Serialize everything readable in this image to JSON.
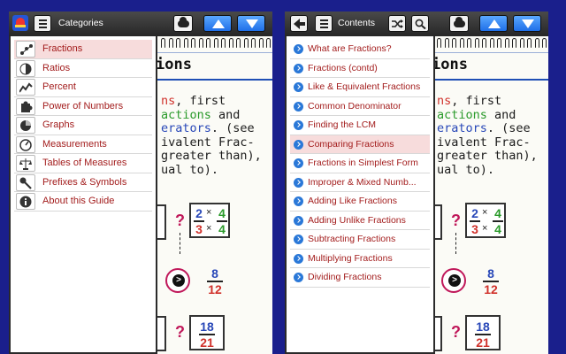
{
  "left_panel": {
    "menu": {
      "title": "Categories",
      "items": [
        {
          "label": "Fractions",
          "icon": "molecule-icon",
          "selected": true
        },
        {
          "label": "Ratios",
          "icon": "half-circle-icon"
        },
        {
          "label": "Percent",
          "icon": "line-graph-icon"
        },
        {
          "label": "Power of Numbers",
          "icon": "puzzle-icon"
        },
        {
          "label": "Graphs",
          "icon": "pie-chart-icon"
        },
        {
          "label": "Measurements",
          "icon": "gauge-icon"
        },
        {
          "label": "Tables of Measures",
          "icon": "scales-icon"
        },
        {
          "label": "Prefixes & Symbols",
          "icon": "key-icon"
        },
        {
          "label": "About this Guide",
          "icon": "info-icon"
        }
      ]
    }
  },
  "right_panel": {
    "menu": {
      "title": "Contents",
      "items": [
        {
          "label": "What are Fractions?"
        },
        {
          "label": "Fractions (contd)"
        },
        {
          "label": "Like & Equivalent Fractions"
        },
        {
          "label": "Common Denominator"
        },
        {
          "label": "Finding the LCM"
        },
        {
          "label": "Comparing Fractions",
          "selected": true
        },
        {
          "label": "Fractions in Simplest Form"
        },
        {
          "label": "Improper & Mixed Numb..."
        },
        {
          "label": "Adding Like Fractions"
        },
        {
          "label": "Adding Unlike Fractions"
        },
        {
          "label": "Subtracting Fractions"
        },
        {
          "label": "Multiplying Fractions"
        },
        {
          "label": "Dividing Fractions"
        }
      ]
    }
  },
  "page": {
    "title_fragment": "ions",
    "text_lines": [
      {
        "parts": [
          {
            "t": "ns",
            "c": "red"
          },
          {
            "t": ", first",
            "c": ""
          }
        ]
      },
      {
        "parts": [
          {
            "t": "actions",
            "c": "green"
          },
          {
            "t": " and",
            "c": ""
          }
        ]
      },
      {
        "parts": [
          {
            "t": "erators",
            "c": "blue"
          },
          {
            "t": ". (see",
            "c": ""
          }
        ]
      },
      {
        "parts": [
          {
            "t": "ivalent Frac-",
            "c": ""
          }
        ]
      },
      {
        "parts": [
          {
            "t": "greater than),",
            "c": ""
          }
        ]
      },
      {
        "parts": [
          {
            "t": "ual to).",
            "c": ""
          }
        ]
      }
    ],
    "question_mark": "?",
    "times_sign": "×",
    "compare_symbol": ">",
    "frac_a": {
      "num1": "2",
      "den1": "3",
      "num2": "4",
      "den2": "4"
    },
    "result": {
      "num": "8",
      "den": "12"
    },
    "frac_b": {
      "num": "18",
      "den": "21"
    }
  },
  "colors": {
    "background": "#1a1f8c",
    "menu_label": "#a31d1d",
    "selected_row": "#f7dcdc",
    "accent_blue": "#1f6fe8",
    "bullet_blue": "#2a78d8"
  }
}
